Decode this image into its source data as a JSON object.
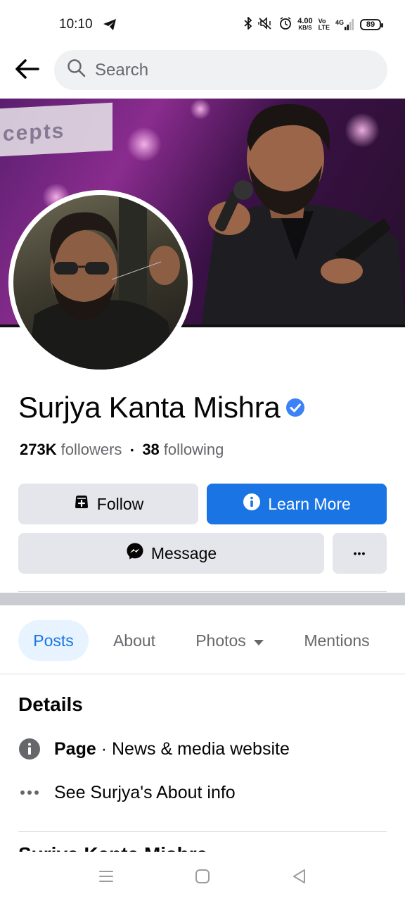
{
  "status_bar": {
    "time": "10:10",
    "net_speed_value": "4.00",
    "net_speed_unit": "KB/S",
    "volte_top": "Vo",
    "volte_bottom": "LTE",
    "network": "4G",
    "battery": "89"
  },
  "search": {
    "placeholder": "Search"
  },
  "cover": {
    "sign_text": "cepts"
  },
  "profile": {
    "name": "Surjya Kanta Mishra",
    "followers_count": "273K",
    "followers_label": "followers",
    "separator": "•",
    "following_count": "38",
    "following_label": "following"
  },
  "actions": {
    "follow_label": "Follow",
    "learn_more_label": "Learn More",
    "message_label": "Message",
    "more_label": "•••"
  },
  "tabs": [
    {
      "label": "Posts",
      "active": true
    },
    {
      "label": "About",
      "active": false
    },
    {
      "label": "Photos",
      "active": false
    },
    {
      "label": "Mentions",
      "active": false
    }
  ],
  "details": {
    "title": "Details",
    "page_label": "Page",
    "page_separator": " · ",
    "page_category": "News & media website",
    "about_link": "See Surjya's About info",
    "cut_off_text": "Surjya Kanta Mishra"
  },
  "colors": {
    "accent": "#1b74e4",
    "button_gray": "#e4e6eb",
    "tab_active_bg": "#e7f3ff",
    "text_secondary": "#65676b"
  }
}
